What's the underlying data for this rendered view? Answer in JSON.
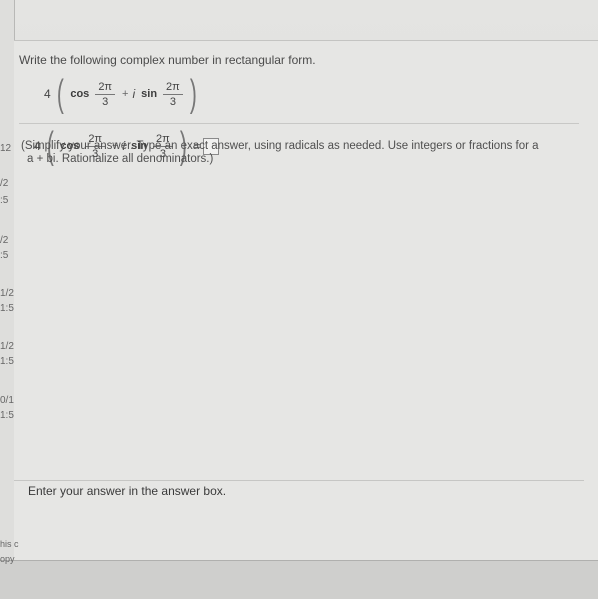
{
  "left_fragments": [
    "12",
    ":5",
    "/2",
    ":5",
    "/2",
    ":5",
    "1/2",
    "1:5",
    "1/2",
    "1:5",
    "0/1",
    "1:5"
  ],
  "question": {
    "prompt": "Write the following complex number in rectangular form.",
    "expression": {
      "coefficient": "4",
      "cos_label": "cos",
      "sin_label": "sin",
      "numerator": "2π",
      "denominator": "3",
      "plus": "+",
      "imag": "i"
    },
    "equals": "=",
    "hint_line1": "(Simplify your answer. Type an exact answer, using radicals as needed. Use integers or fractions for a",
    "hint_line2": "a + bi. Rationalize all denominators.)"
  },
  "footer": {
    "message": "Enter your answer in the answer box."
  },
  "bottom_fragments": [
    "his c",
    "opy"
  ]
}
